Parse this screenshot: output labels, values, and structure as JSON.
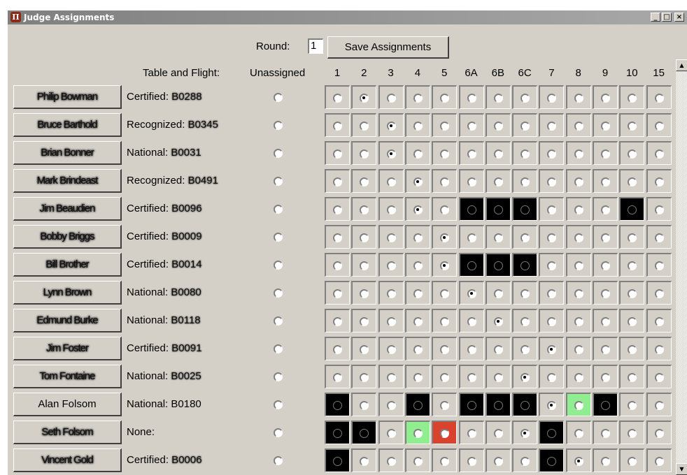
{
  "window": {
    "title": "Judge Assignments",
    "minimize_label": "_",
    "maximize_label": "□",
    "close_label": "×"
  },
  "toolbar": {
    "round_label": "Round:",
    "round_value": "1",
    "save_label": "Save Assignments"
  },
  "header": {
    "table_flight_label": "Table and Flight:",
    "unassigned_label": "Unassigned",
    "columns": [
      "1",
      "2",
      "3",
      "4",
      "5",
      "6A",
      "6B",
      "6C",
      "7",
      "8",
      "9",
      "10",
      "15"
    ]
  },
  "rows": [
    {
      "name": "Philip Bowman",
      "redacted": true,
      "cert_prefix": "Certified:",
      "cert_code": "B0288",
      "redacted_code": true,
      "selected": 1,
      "black": [],
      "green": [],
      "red": []
    },
    {
      "name": "Bruce Barthold",
      "redacted": true,
      "cert_prefix": "Recognized:",
      "cert_code": "B0345",
      "redacted_code": true,
      "selected": 2,
      "black": [],
      "green": [],
      "red": []
    },
    {
      "name": "Brian Bonner",
      "redacted": true,
      "cert_prefix": "National:",
      "cert_code": "B0031",
      "redacted_code": true,
      "selected": 2,
      "black": [],
      "green": [],
      "red": []
    },
    {
      "name": "Mark Brindeast",
      "redacted": true,
      "cert_prefix": "Recognized:",
      "cert_code": "B0491",
      "redacted_code": true,
      "selected": 3,
      "black": [],
      "green": [],
      "red": []
    },
    {
      "name": "Jim Beaudien",
      "redacted": true,
      "cert_prefix": "Certified:",
      "cert_code": "B0096",
      "redacted_code": true,
      "selected": 3,
      "black": [
        5,
        6,
        7,
        11
      ],
      "green": [],
      "red": []
    },
    {
      "name": "Bobby Briggs",
      "redacted": true,
      "cert_prefix": "Certified:",
      "cert_code": "B0009",
      "redacted_code": true,
      "selected": 4,
      "black": [],
      "green": [],
      "red": []
    },
    {
      "name": "Bill Brother",
      "redacted": true,
      "cert_prefix": "Certified:",
      "cert_code": "B0014",
      "redacted_code": true,
      "selected": 4,
      "black": [
        5,
        6,
        7
      ],
      "green": [],
      "red": []
    },
    {
      "name": "Lynn Brown",
      "redacted": true,
      "cert_prefix": "National:",
      "cert_code": "B0080",
      "redacted_code": true,
      "selected": 5,
      "black": [],
      "green": [],
      "red": []
    },
    {
      "name": "Edmund Burke",
      "redacted": true,
      "cert_prefix": "National:",
      "cert_code": "B0118",
      "redacted_code": true,
      "selected": 6,
      "black": [],
      "green": [],
      "red": []
    },
    {
      "name": "Jim Foster",
      "redacted": true,
      "cert_prefix": "Certified:",
      "cert_code": "B0091",
      "redacted_code": true,
      "selected": 8,
      "black": [],
      "green": [],
      "red": []
    },
    {
      "name": "Tom Fontaine",
      "redacted": true,
      "cert_prefix": "National:",
      "cert_code": "B0025",
      "redacted_code": true,
      "selected": 7,
      "black": [],
      "green": [],
      "red": []
    },
    {
      "name": "Alan Folsom",
      "redacted": false,
      "cert_prefix": "National:",
      "cert_code": "B0180",
      "redacted_code": false,
      "selected": 8,
      "black": [
        0,
        3,
        5,
        6,
        7,
        10
      ],
      "green": [
        9
      ],
      "red": []
    },
    {
      "name": "Seth Folsom",
      "redacted": true,
      "cert_prefix": "None:",
      "cert_code": "",
      "redacted_code": false,
      "selected": 7,
      "black": [
        0,
        1,
        8
      ],
      "green": [
        3
      ],
      "red": [
        4
      ]
    },
    {
      "name": "Vincent Gold",
      "redacted": true,
      "cert_prefix": "Certified:",
      "cert_code": "B0006",
      "redacted_code": true,
      "selected": 9,
      "black": [
        0,
        8
      ],
      "green": [],
      "red": []
    }
  ],
  "colors": {
    "window_bg": "#d4d0c8",
    "blocked": "#000000",
    "suggested": "#90ee90",
    "conflict": "#d9432d"
  }
}
